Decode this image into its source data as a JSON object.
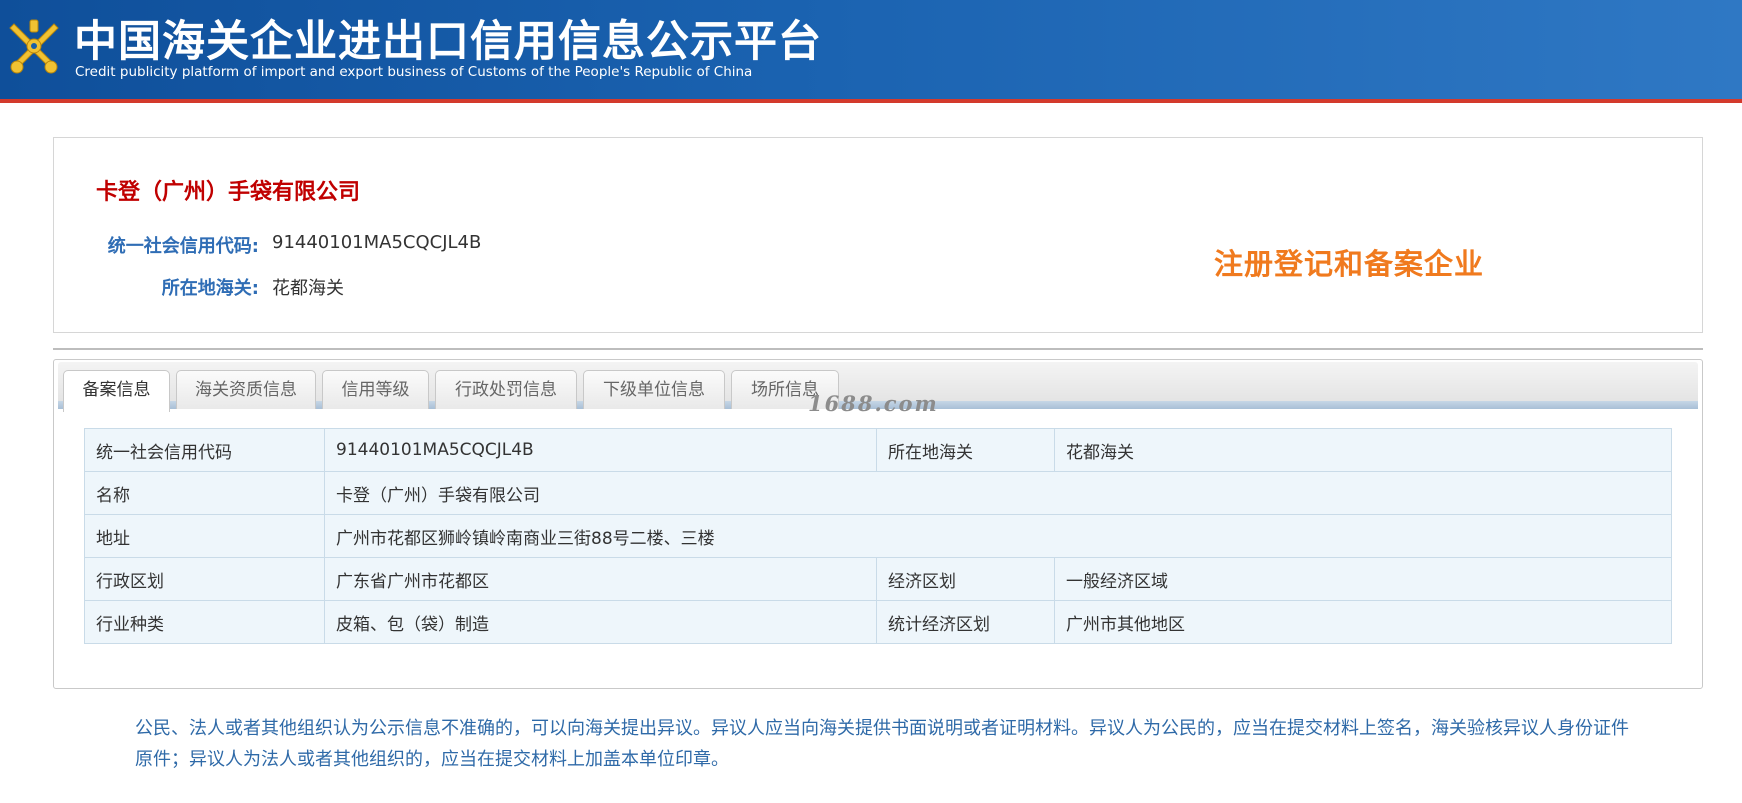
{
  "header": {
    "title": "中国海关企业进出口信用信息公示平台",
    "subtitle": "Credit publicity platform of import and export business of Customs of the People's Republic of China",
    "logo_icon": "customs-emblem-icon",
    "background_color": "#1a5ea8",
    "accent_line_color": "#d33a2c"
  },
  "company": {
    "name": "卡登（广州）手袋有限公司",
    "fields": [
      {
        "label": "统一社会信用代码:",
        "value": "91440101MA5CQCJL4B"
      },
      {
        "label": "所在地海关:",
        "value": "花都海关"
      }
    ],
    "status": "注册登记和备案企业",
    "name_color": "#c00000",
    "status_color": "#f07a1e"
  },
  "tabs": [
    {
      "label": "备案信息",
      "active": true
    },
    {
      "label": "海关资质信息",
      "active": false
    },
    {
      "label": "信用等级",
      "active": false
    },
    {
      "label": "行政处罚信息",
      "active": false
    },
    {
      "label": "下级单位信息",
      "active": false
    },
    {
      "label": "场所信息",
      "active": false
    }
  ],
  "watermark": "1688.com",
  "table": {
    "rows": [
      {
        "label1": "统一社会信用代码",
        "value1": "91440101MA5CQCJL4B",
        "label2": "所在地海关",
        "value2": "花都海关"
      },
      {
        "label1": "名称",
        "value1": "卡登（广州）手袋有限公司"
      },
      {
        "label1": "地址",
        "value1": "广州市花都区狮岭镇岭南商业三街88号二楼、三楼"
      },
      {
        "label1": "行政区划",
        "value1": "广东省广州市花都区",
        "label2": "经济区划",
        "value2": "一般经济区域"
      },
      {
        "label1": "行业种类",
        "value1": "皮箱、包（袋）制造",
        "label2": "统计经济区划",
        "value2": "广州市其他地区"
      }
    ]
  },
  "notice": "公民、法人或者其他组织认为公示信息不准确的，可以向海关提出异议。异议人应当向海关提供书面说明或者证明材料。异议人为公民的，应当在提交材料上签名，海关验核异议人身份证件原件；异议人为法人或者其他组织的，应当在提交材料上加盖本单位印章。"
}
